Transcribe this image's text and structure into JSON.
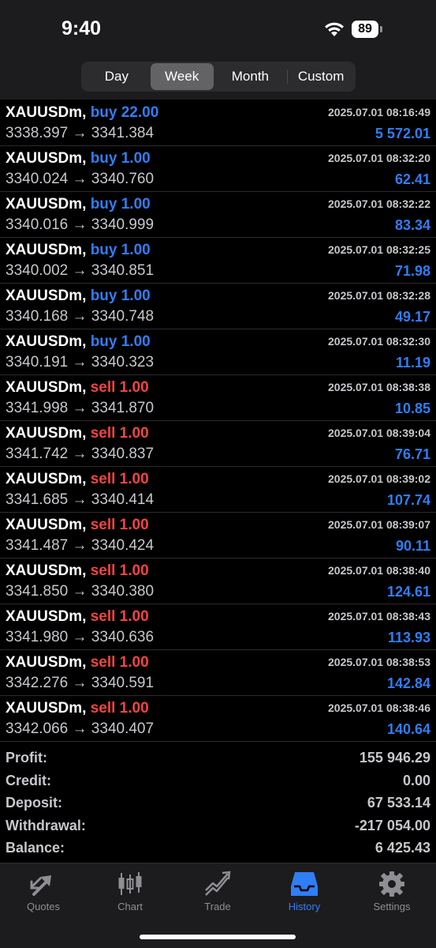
{
  "status_bar": {
    "time": "9:40",
    "battery_level": "89"
  },
  "periods": {
    "tabs": [
      "Day",
      "Week",
      "Month",
      "Custom"
    ],
    "selected": "Week"
  },
  "deals": [
    {
      "symbol": "XAUUSDm,",
      "type": "buy",
      "volume": "buy 22.00",
      "prices": "3338.397 → 3341.384",
      "time": "2025.07.01 08:16:49",
      "profit": "5 572.01"
    },
    {
      "symbol": "XAUUSDm,",
      "type": "buy",
      "volume": "buy 1.00",
      "prices": "3340.024 → 3340.760",
      "time": "2025.07.01 08:32:20",
      "profit": "62.41"
    },
    {
      "symbol": "XAUUSDm,",
      "type": "buy",
      "volume": "buy 1.00",
      "prices": "3340.016 → 3340.999",
      "time": "2025.07.01 08:32:22",
      "profit": "83.34"
    },
    {
      "symbol": "XAUUSDm,",
      "type": "buy",
      "volume": "buy 1.00",
      "prices": "3340.002 → 3340.851",
      "time": "2025.07.01 08:32:25",
      "profit": "71.98"
    },
    {
      "symbol": "XAUUSDm,",
      "type": "buy",
      "volume": "buy 1.00",
      "prices": "3340.168 → 3340.748",
      "time": "2025.07.01 08:32:28",
      "profit": "49.17"
    },
    {
      "symbol": "XAUUSDm,",
      "type": "buy",
      "volume": "buy 1.00",
      "prices": "3340.191 → 3340.323",
      "time": "2025.07.01 08:32:30",
      "profit": "11.19"
    },
    {
      "symbol": "XAUUSDm,",
      "type": "sell",
      "volume": "sell 1.00",
      "prices": "3341.998 → 3341.870",
      "time": "2025.07.01 08:38:38",
      "profit": "10.85"
    },
    {
      "symbol": "XAUUSDm,",
      "type": "sell",
      "volume": "sell 1.00",
      "prices": "3341.742 → 3340.837",
      "time": "2025.07.01 08:39:04",
      "profit": "76.71"
    },
    {
      "symbol": "XAUUSDm,",
      "type": "sell",
      "volume": "sell 1.00",
      "prices": "3341.685 → 3340.414",
      "time": "2025.07.01 08:39:02",
      "profit": "107.74"
    },
    {
      "symbol": "XAUUSDm,",
      "type": "sell",
      "volume": "sell 1.00",
      "prices": "3341.487 → 3340.424",
      "time": "2025.07.01 08:39:07",
      "profit": "90.11"
    },
    {
      "symbol": "XAUUSDm,",
      "type": "sell",
      "volume": "sell 1.00",
      "prices": "3341.850 → 3340.380",
      "time": "2025.07.01 08:38:40",
      "profit": "124.61"
    },
    {
      "symbol": "XAUUSDm,",
      "type": "sell",
      "volume": "sell 1.00",
      "prices": "3341.980 → 3340.636",
      "time": "2025.07.01 08:38:43",
      "profit": "113.93"
    },
    {
      "symbol": "XAUUSDm,",
      "type": "sell",
      "volume": "sell 1.00",
      "prices": "3342.276 → 3340.591",
      "time": "2025.07.01 08:38:53",
      "profit": "142.84"
    },
    {
      "symbol": "XAUUSDm,",
      "type": "sell",
      "volume": "sell 1.00",
      "prices": "3342.066 → 3340.407",
      "time": "2025.07.01 08:38:46",
      "profit": "140.64"
    }
  ],
  "summary": {
    "profit_label": "Profit:",
    "profit": "155 946.29",
    "credit_label": "Credit:",
    "credit": "0.00",
    "deposit_label": "Deposit:",
    "deposit": "67 533.14",
    "withdrawal_label": "Withdrawal:",
    "withdrawal": "-217 054.00",
    "balance_label": "Balance:",
    "balance": "6 425.43"
  },
  "tab_bar": {
    "items": [
      {
        "label": "Quotes",
        "icon": "quotes-icon"
      },
      {
        "label": "Chart",
        "icon": "chart-icon"
      },
      {
        "label": "Trade",
        "icon": "trade-icon"
      },
      {
        "label": "History",
        "icon": "history-icon"
      },
      {
        "label": "Settings",
        "icon": "settings-icon"
      }
    ],
    "active": "History"
  },
  "colors": {
    "buy": "#2f7ef5",
    "sell": "#f5443f",
    "profit": "#2f7ef5",
    "active_tab": "#2f7ef5",
    "inactive_tab": "#8e8e93"
  }
}
